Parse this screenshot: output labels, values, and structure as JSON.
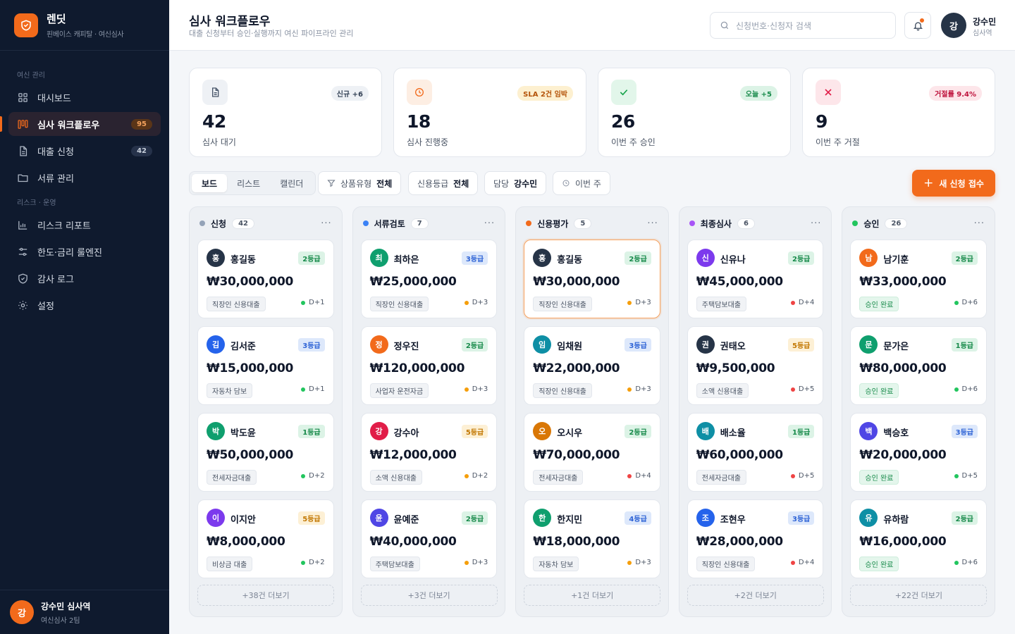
{
  "brand": {
    "name": "렌딧",
    "subtitle": "핀베이스 캐피탈 · 여신심사"
  },
  "sidebar": {
    "section_loan": "여신 관리",
    "section_risk": "리스크 · 운영",
    "items": [
      {
        "label": "대시보드",
        "icon": "grid-icon"
      },
      {
        "label": "심사 워크플로우",
        "badge": "95",
        "icon": "kanban-icon"
      },
      {
        "label": "대출 신청",
        "badge": "42",
        "icon": "document-icon"
      },
      {
        "label": "서류 관리",
        "icon": "folder-icon"
      },
      {
        "label": "리스크 리포트",
        "icon": "bar-chart-icon"
      },
      {
        "label": "한도·금리 룰엔진",
        "icon": "sliders-icon"
      },
      {
        "label": "감사 로그",
        "icon": "shield-icon"
      },
      {
        "label": "설정",
        "icon": "gear-icon"
      }
    ],
    "user": {
      "initial": "강",
      "name": "강수민 심사역",
      "team": "여신심사 2팀"
    }
  },
  "header": {
    "title": "심사 워크플로우",
    "subtitle": "대출 신청부터 승인·실행까지 여신 파이프라인 관리",
    "search_placeholder": "신청번호·신청자 검색",
    "user": {
      "initial": "강",
      "name": "강수민",
      "role": "심사역"
    }
  },
  "stats": [
    {
      "value": "42",
      "label": "심사 대기",
      "badge": "신규 +6",
      "icon": "document-icon",
      "color": "#64748b"
    },
    {
      "value": "18",
      "label": "심사 진행중",
      "badge": "SLA 2건 임박",
      "icon": "clock-icon",
      "color": "#f26a1b"
    },
    {
      "value": "26",
      "label": "이번 주 승인",
      "badge": "오늘 +5",
      "icon": "check-icon",
      "color": "#16a34a"
    },
    {
      "value": "9",
      "label": "이번 주 거절",
      "badge": "거절률 9.4%",
      "icon": "x-icon",
      "color": "#e11d48"
    }
  ],
  "toolbar": {
    "view_tabs": [
      "보드",
      "리스트",
      "캘린더"
    ],
    "filter_product_label": "상품유형",
    "filter_product_value": "전체",
    "filter_grade_label": "신용등급",
    "filter_grade_value": "전체",
    "filter_owner_label": "담당",
    "filter_owner_value": "강수민",
    "filter_period": "이번 주",
    "new_button": "새 신청 접수"
  },
  "board": {
    "columns": [
      {
        "title": "신청",
        "count": "42",
        "dot": "#94a3b8",
        "more_link": "+38건 더보기",
        "cards": [
          {
            "initial": "홍",
            "name": "홍길동",
            "grade": "2등급",
            "g": 2,
            "amount": "₩30,000,000",
            "product": "직장인 신용대출",
            "due": "D+1",
            "due_color": "#22c55e",
            "avatar_color": "#263447"
          },
          {
            "initial": "김",
            "name": "김서준",
            "grade": "3등급",
            "g": 3,
            "amount": "₩15,000,000",
            "product": "자동차 담보",
            "due": "D+1",
            "due_color": "#22c55e",
            "avatar_color": "#2563eb"
          },
          {
            "initial": "박",
            "name": "박도윤",
            "grade": "1등급",
            "g": 1,
            "amount": "₩50,000,000",
            "product": "전세자금대출",
            "due": "D+2",
            "due_color": "#22c55e",
            "avatar_color": "#0f9f6e"
          },
          {
            "initial": "이",
            "name": "이지안",
            "grade": "5등급",
            "g": 5,
            "amount": "₩8,000,000",
            "product": "비상금 대출",
            "due": "D+2",
            "due_color": "#22c55e",
            "avatar_color": "#7c3aed"
          }
        ]
      },
      {
        "title": "서류검토",
        "count": "7",
        "dot": "#3b82f6",
        "more_link": "+3건 더보기",
        "cards": [
          {
            "initial": "최",
            "name": "최하은",
            "grade": "3등급",
            "g": 3,
            "amount": "₩25,000,000",
            "product": "직장인 신용대출",
            "due": "D+3",
            "due_color": "#f59e0b",
            "avatar_color": "#0f9f6e"
          },
          {
            "initial": "정",
            "name": "정우진",
            "grade": "2등급",
            "g": 2,
            "amount": "₩120,000,000",
            "product": "사업자 운전자금",
            "due": "D+3",
            "due_color": "#f59e0b",
            "avatar_color": "#f26a1b"
          },
          {
            "initial": "강",
            "name": "강수아",
            "grade": "5등급",
            "g": 5,
            "amount": "₩12,000,000",
            "product": "소액 신용대출",
            "due": "D+2",
            "due_color": "#f59e0b",
            "avatar_color": "#e11d48"
          },
          {
            "initial": "윤",
            "name": "윤예준",
            "grade": "2등급",
            "g": 2,
            "amount": "₩40,000,000",
            "product": "주택담보대출",
            "due": "D+3",
            "due_color": "#f59e0b",
            "avatar_color": "#4f46e5"
          }
        ]
      },
      {
        "title": "신용평가",
        "count": "5",
        "dot": "#f26a1b",
        "more_link": "+1건 더보기",
        "cards": [
          {
            "initial": "홍",
            "name": "홍길동",
            "grade": "2등급",
            "g": 2,
            "amount": "₩30,000,000",
            "product": "직장인 신용대출",
            "due": "D+3",
            "due_color": "#f59e0b",
            "avatar_color": "#263447"
          },
          {
            "initial": "임",
            "name": "임채원",
            "grade": "3등급",
            "g": 3,
            "amount": "₩22,000,000",
            "product": "직장인 신용대출",
            "due": "D+3",
            "due_color": "#f59e0b",
            "avatar_color": "#0e8fa5"
          },
          {
            "initial": "오",
            "name": "오시우",
            "grade": "2등급",
            "g": 2,
            "amount": "₩70,000,000",
            "product": "전세자금대출",
            "due": "D+4",
            "due_color": "#ef4444",
            "avatar_color": "#d97706"
          },
          {
            "initial": "한",
            "name": "한지민",
            "grade": "4등급",
            "g": 4,
            "amount": "₩18,000,000",
            "product": "자동차 담보",
            "due": "D+3",
            "due_color": "#f59e0b",
            "avatar_color": "#0f9f6e"
          }
        ]
      },
      {
        "title": "최종심사",
        "count": "6",
        "dot": "#a855f7",
        "more_link": "+2건 더보기",
        "cards": [
          {
            "initial": "신",
            "name": "신유나",
            "grade": "2등급",
            "g": 2,
            "amount": "₩45,000,000",
            "product": "주택담보대출",
            "due": "D+4",
            "due_color": "#ef4444",
            "avatar_color": "#7c3aed"
          },
          {
            "initial": "권",
            "name": "권태오",
            "grade": "5등급",
            "g": 5,
            "amount": "₩9,500,000",
            "product": "소액 신용대출",
            "due": "D+5",
            "due_color": "#ef4444",
            "avatar_color": "#263447"
          },
          {
            "initial": "배",
            "name": "배소율",
            "grade": "1등급",
            "g": 1,
            "amount": "₩60,000,000",
            "product": "전세자금대출",
            "due": "D+5",
            "due_color": "#ef4444",
            "avatar_color": "#0e8fa5"
          },
          {
            "initial": "조",
            "name": "조현우",
            "grade": "3등급",
            "g": 3,
            "amount": "₩28,000,000",
            "product": "직장인 신용대출",
            "due": "D+4",
            "due_color": "#ef4444",
            "avatar_color": "#2563eb"
          }
        ]
      },
      {
        "title": "승인",
        "count": "26",
        "dot": "#22c55e",
        "more_link": "+22건 더보기",
        "cards": [
          {
            "initial": "남",
            "name": "남기훈",
            "grade": "2등급",
            "g": 2,
            "amount": "₩33,000,000",
            "product": "승인 완료",
            "ok": true,
            "due": "D+6",
            "due_color": "#22c55e",
            "avatar_color": "#f26a1b"
          },
          {
            "initial": "문",
            "name": "문가은",
            "grade": "1등급",
            "g": 1,
            "amount": "₩80,000,000",
            "product": "승인 완료",
            "ok": true,
            "due": "D+6",
            "due_color": "#22c55e",
            "avatar_color": "#0f9f6e"
          },
          {
            "initial": "백",
            "name": "백승호",
            "grade": "3등급",
            "g": 3,
            "amount": "₩20,000,000",
            "product": "승인 완료",
            "ok": true,
            "due": "D+5",
            "due_color": "#22c55e",
            "avatar_color": "#4f46e5"
          },
          {
            "initial": "유",
            "name": "유하람",
            "grade": "2등급",
            "g": 2,
            "amount": "₩16,000,000",
            "product": "승인 완료",
            "ok": true,
            "due": "D+6",
            "due_color": "#22c55e",
            "avatar_color": "#0e8fa5"
          }
        ]
      }
    ],
    "highlighted": {
      "column": 2,
      "card": 0
    }
  }
}
